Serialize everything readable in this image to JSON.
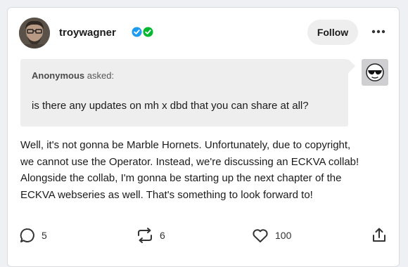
{
  "post": {
    "username": "troywagner",
    "follow_label": "Follow",
    "ask": {
      "asker": "Anonymous",
      "asked_label": "asked:",
      "question": "is there any updates on mh x dbd that you can share at all?"
    },
    "answer_lines": [
      "Well, it's not gonna be Marble Hornets. Unfortunately, due to copyright,",
      "we cannot use the Operator. Instead, we're discussing an ECKVA collab!",
      "Alongside the collab, I'm gonna be starting up the next chapter of the",
      "ECKVA webseries as well. That's something to look forward to!"
    ],
    "stats": {
      "replies": "5",
      "reblogs": "6",
      "likes": "100"
    }
  },
  "colors": {
    "badge_blue": "#1d9bf0",
    "badge_green": "#00b82e",
    "background": "#eef0f3",
    "ask_background": "#eeeeef"
  },
  "icons": {
    "more": "more-dots-icon",
    "reply": "reply-bubble-icon",
    "reblog": "reblog-arrows-icon",
    "like": "heart-icon",
    "share": "share-icon"
  }
}
